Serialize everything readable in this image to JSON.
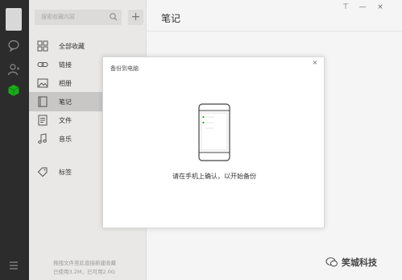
{
  "sidebar": {
    "search_placeholder": "搜索收藏内容",
    "add_label": "+",
    "items": [
      {
        "label": "全部收藏",
        "icon": "grid-icon"
      },
      {
        "label": "链接",
        "icon": "link-icon"
      },
      {
        "label": "相册",
        "icon": "image-icon"
      },
      {
        "label": "笔记",
        "icon": "note-icon"
      },
      {
        "label": "文件",
        "icon": "file-icon"
      },
      {
        "label": "音乐",
        "icon": "music-icon"
      },
      {
        "label": "标签",
        "icon": "tag-icon"
      }
    ],
    "active_item": "笔记",
    "storage_line1": "拖拽文件至此直接新建收藏",
    "storage_line2": "已使用3.2M，已可用2.0G"
  },
  "main": {
    "title": "笔记"
  },
  "dialog": {
    "title": "备份到电脑",
    "close": "×",
    "message": "请在手机上确认，以开始备份"
  },
  "window": {
    "pin": "⊤",
    "minimize": "—",
    "close": "×"
  },
  "watermark": {
    "text": "笑城科技"
  },
  "colors": {
    "rail": "#2c2c2c",
    "sidebar": "#e9e8e7",
    "active": "#c8c7c6",
    "accent_green": "#1aad19"
  }
}
